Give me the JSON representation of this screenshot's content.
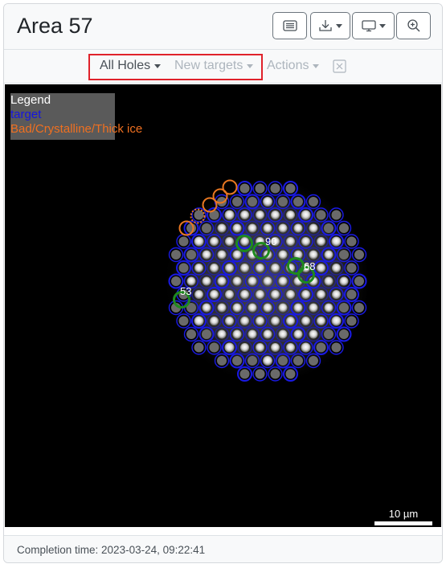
{
  "header": {
    "title": "Area 57",
    "buttons": [
      {
        "name": "list-view-button",
        "icon": "list-icon",
        "dropdown": false
      },
      {
        "name": "download-button",
        "icon": "download-icon",
        "dropdown": true
      },
      {
        "name": "display-button",
        "icon": "monitor-icon",
        "dropdown": true
      },
      {
        "name": "zoom-button",
        "icon": "zoom-in-icon",
        "dropdown": false
      }
    ]
  },
  "toolbar": {
    "holes_filter": "All Holes",
    "new_targets": "New targets",
    "actions": "Actions"
  },
  "legend": {
    "title": "Legend",
    "items": [
      {
        "label": "target",
        "color": "#1515e0"
      },
      {
        "label": "Bad/Crystalline/Thick ice",
        "color": "#f07020"
      }
    ]
  },
  "image": {
    "labels": [
      "90",
      "68",
      "53"
    ],
    "scale_bar": "10 µm",
    "colors": {
      "target": "#1a1ae6",
      "bad": "#e87722",
      "acquired": "#1e8a1e"
    }
  },
  "footer": {
    "completion": "Completion time: 2023-03-24, 09:22:41"
  }
}
